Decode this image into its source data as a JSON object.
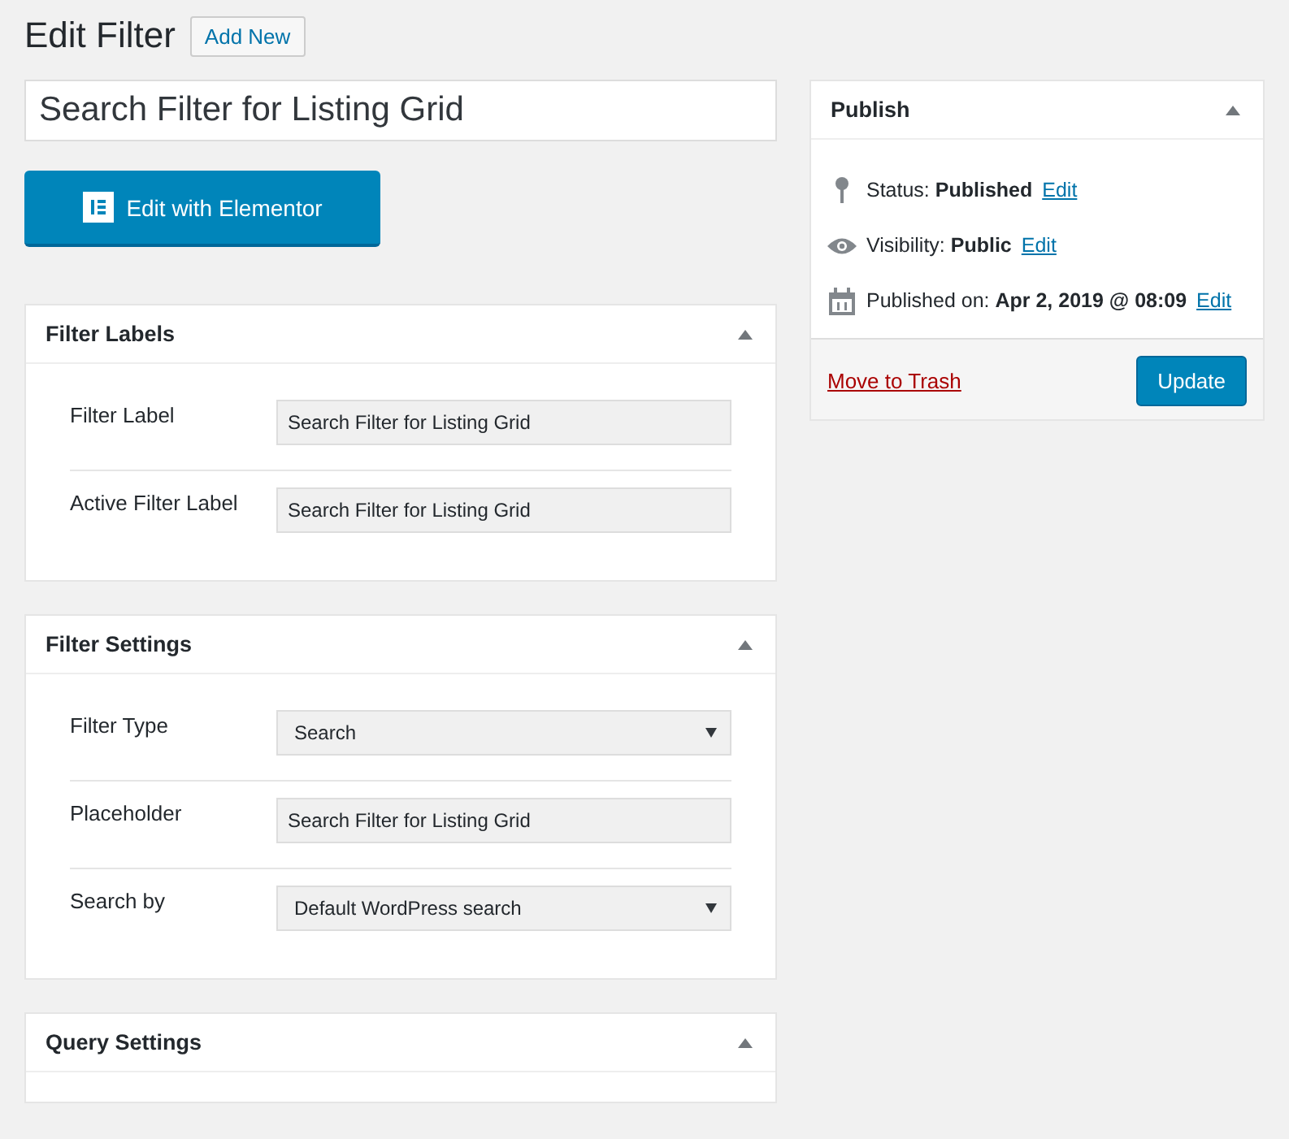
{
  "heading": {
    "title": "Edit Filter",
    "add_new": "Add New"
  },
  "post_title": "Search Filter for Listing Grid",
  "builder_button": "Edit with Elementor",
  "panels": [
    {
      "title": "Filter Labels",
      "fields": [
        {
          "kind": "text",
          "label": "Filter Label",
          "value": "Search Filter for Listing Grid"
        },
        {
          "kind": "text",
          "label": "Active Filter Label",
          "value": "Search Filter for Listing Grid"
        }
      ]
    },
    {
      "title": "Filter Settings",
      "fields": [
        {
          "kind": "select",
          "label": "Filter Type",
          "value": "Search"
        },
        {
          "kind": "text",
          "label": "Placeholder",
          "value": "Search Filter for Listing Grid"
        },
        {
          "kind": "select",
          "label": "Search by",
          "value": "Default WordPress search"
        }
      ]
    },
    {
      "title": "Query Settings"
    }
  ],
  "publish": {
    "title": "Publish",
    "rows": [
      {
        "kind": "pin",
        "text": "Status: **Published**",
        "link": "Edit"
      },
      {
        "kind": "eye",
        "text": "Visibility: **Public**",
        "link": "Edit"
      },
      {
        "kind": "calendar",
        "text": "Published on: **Apr 2, 2019 @ 08:09**",
        "link": "Edit"
      }
    ],
    "trash": "Move to Trash",
    "update": "Update"
  }
}
